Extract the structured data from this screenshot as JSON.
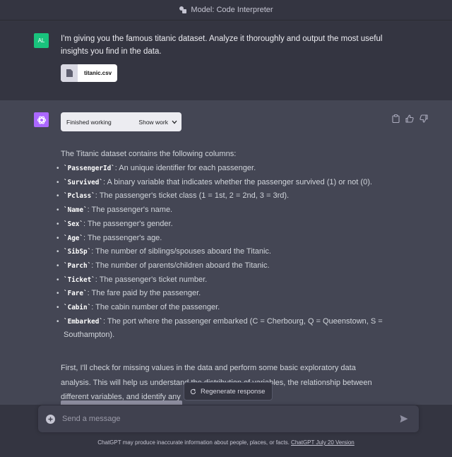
{
  "header": {
    "model_label": "Model: Code Interpreter",
    "model_icon": "code-interpreter-icon"
  },
  "user_message": {
    "avatar_initials": "AL",
    "avatar_color": "#19c37d",
    "text": "I'm giving you the famous titanic dataset. Analyze it thoroughly and output the most useful insights you find in the data.",
    "attachment": {
      "file_name": "titanic.csv",
      "icon": "document-icon"
    }
  },
  "assistant_message": {
    "avatar_color": "#ab68ff",
    "status": {
      "label": "Finished working",
      "show_work": "Show work"
    },
    "intro": "The Titanic dataset contains the following columns:",
    "columns": [
      {
        "name": "`PassengerId`",
        "desc": ": An unique identifier for each passenger."
      },
      {
        "name": "`Survived`",
        "desc": ": A binary variable that indicates whether the passenger survived (1) or not (0)."
      },
      {
        "name": "`Pclass`",
        "desc": ": The passenger's ticket class (1 = 1st, 2 = 2nd, 3 = 3rd)."
      },
      {
        "name": "`Name`",
        "desc": ": The passenger's name."
      },
      {
        "name": "`Sex`",
        "desc": ": The passenger's gender."
      },
      {
        "name": "`Age`",
        "desc": ": The passenger's age."
      },
      {
        "name": "`SibSp`",
        "desc": ": The number of siblings/spouses aboard the Titanic."
      },
      {
        "name": "`Parch`",
        "desc": ": The number of parents/children aboard the Titanic."
      },
      {
        "name": "`Ticket`",
        "desc": ": The passenger's ticket number."
      },
      {
        "name": "`Fare`",
        "desc": ": The fare paid by the passenger."
      },
      {
        "name": "`Cabin`",
        "desc": ": The cabin number of the passenger."
      },
      {
        "name": "`Embarked`",
        "desc": ": The port where the passenger embarked (C = Cherbourg, Q = Queenstown, S = Southampton)."
      }
    ],
    "followup": "First, I'll check for missing values in the data and perform some basic exploratory data analysis. This will help us understand the distribution of variables, the relationship between different variables, and identify any",
    "actions": [
      "clipboard-icon",
      "thumbs-up-icon",
      "thumbs-down-icon"
    ]
  },
  "regenerate": {
    "label": "Regenerate response"
  },
  "composer": {
    "placeholder": "Send a message"
  },
  "footer": {
    "text": "ChatGPT may produce inaccurate information about people, places, or facts. ",
    "link": "ChatGPT July 20 Version"
  }
}
